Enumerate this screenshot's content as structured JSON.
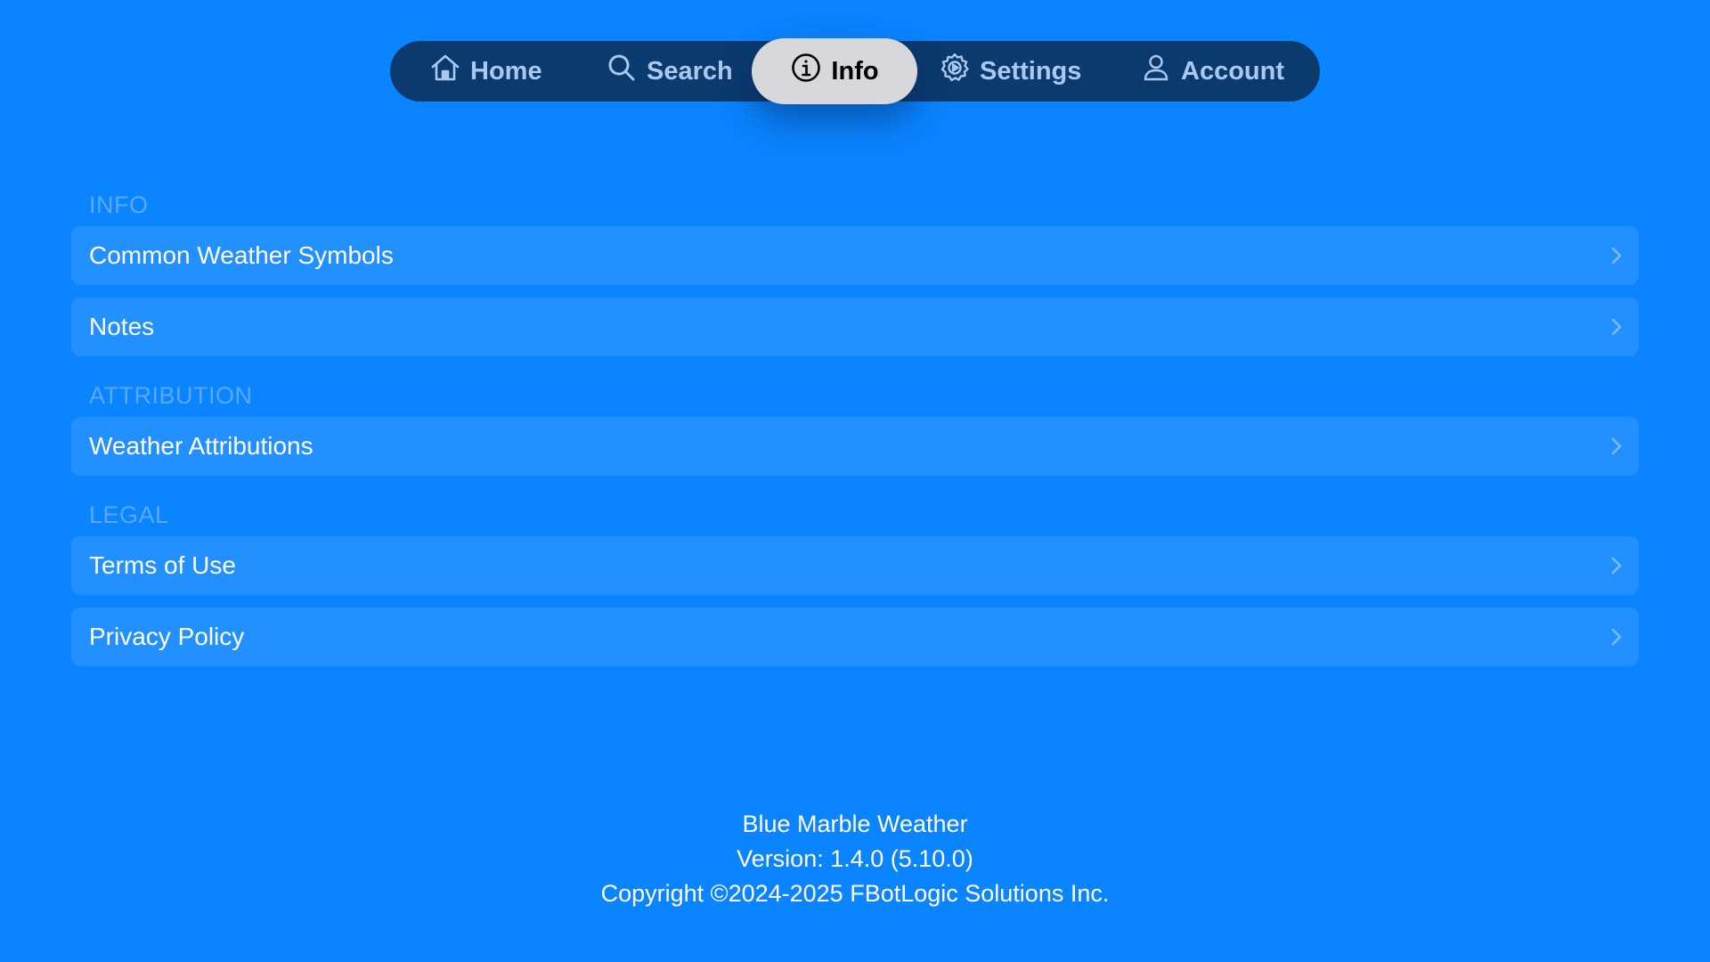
{
  "tabbar": {
    "tabs": [
      {
        "id": "home",
        "label": "Home",
        "icon": "house-icon"
      },
      {
        "id": "search",
        "label": "Search",
        "icon": "magnifier-icon"
      },
      {
        "id": "info",
        "label": "Info",
        "icon": "info-circle-icon",
        "selected": true
      },
      {
        "id": "settings",
        "label": "Settings",
        "icon": "gear-icon"
      },
      {
        "id": "account",
        "label": "Account",
        "icon": "person-icon"
      }
    ]
  },
  "sections": {
    "info": {
      "header": "INFO",
      "items": [
        "Common Weather Symbols",
        "Notes"
      ]
    },
    "attribution": {
      "header": "ATTRIBUTION",
      "items": [
        "Weather Attributions"
      ]
    },
    "legal": {
      "header": "LEGAL",
      "items": [
        "Terms of Use",
        "Privacy Policy"
      ]
    }
  },
  "footer": {
    "app_name": "Blue Marble Weather",
    "version": "Version: 1.4.0 (5.10.0)",
    "copyright": "Copyright ©2024-2025 FBotLogic Solutions Inc."
  },
  "colors": {
    "background": "#0a84ff",
    "row_background": "#2290ff",
    "tabbar_background": "#0b3a6f",
    "active_tab_background": "#d8d8dc",
    "section_header": "#5aa9ff"
  }
}
